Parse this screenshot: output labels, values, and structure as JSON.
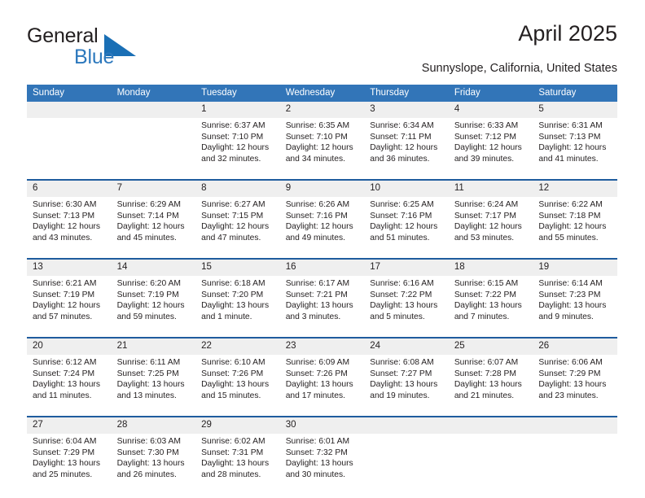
{
  "brand": {
    "name_part1": "General",
    "name_part2": "Blue",
    "flag_icon": "blue-triangle-flag-icon"
  },
  "header": {
    "title": "April 2025",
    "subtitle": "Sunnyslope, California, United States"
  },
  "colors": {
    "header_blue": "#3275b8",
    "separator_blue": "#1f5c9e",
    "daynum_band": "#efefef",
    "brand_blue": "#2c78bd",
    "text": "#231f20"
  },
  "weekdays": [
    "Sunday",
    "Monday",
    "Tuesday",
    "Wednesday",
    "Thursday",
    "Friday",
    "Saturday"
  ],
  "weeks": [
    [
      {
        "day": "",
        "sunrise": "",
        "sunset": "",
        "daylight1": "",
        "daylight2": ""
      },
      {
        "day": "",
        "sunrise": "",
        "sunset": "",
        "daylight1": "",
        "daylight2": ""
      },
      {
        "day": "1",
        "sunrise": "Sunrise: 6:37 AM",
        "sunset": "Sunset: 7:10 PM",
        "daylight1": "Daylight: 12 hours",
        "daylight2": "and 32 minutes."
      },
      {
        "day": "2",
        "sunrise": "Sunrise: 6:35 AM",
        "sunset": "Sunset: 7:10 PM",
        "daylight1": "Daylight: 12 hours",
        "daylight2": "and 34 minutes."
      },
      {
        "day": "3",
        "sunrise": "Sunrise: 6:34 AM",
        "sunset": "Sunset: 7:11 PM",
        "daylight1": "Daylight: 12 hours",
        "daylight2": "and 36 minutes."
      },
      {
        "day": "4",
        "sunrise": "Sunrise: 6:33 AM",
        "sunset": "Sunset: 7:12 PM",
        "daylight1": "Daylight: 12 hours",
        "daylight2": "and 39 minutes."
      },
      {
        "day": "5",
        "sunrise": "Sunrise: 6:31 AM",
        "sunset": "Sunset: 7:13 PM",
        "daylight1": "Daylight: 12 hours",
        "daylight2": "and 41 minutes."
      }
    ],
    [
      {
        "day": "6",
        "sunrise": "Sunrise: 6:30 AM",
        "sunset": "Sunset: 7:13 PM",
        "daylight1": "Daylight: 12 hours",
        "daylight2": "and 43 minutes."
      },
      {
        "day": "7",
        "sunrise": "Sunrise: 6:29 AM",
        "sunset": "Sunset: 7:14 PM",
        "daylight1": "Daylight: 12 hours",
        "daylight2": "and 45 minutes."
      },
      {
        "day": "8",
        "sunrise": "Sunrise: 6:27 AM",
        "sunset": "Sunset: 7:15 PM",
        "daylight1": "Daylight: 12 hours",
        "daylight2": "and 47 minutes."
      },
      {
        "day": "9",
        "sunrise": "Sunrise: 6:26 AM",
        "sunset": "Sunset: 7:16 PM",
        "daylight1": "Daylight: 12 hours",
        "daylight2": "and 49 minutes."
      },
      {
        "day": "10",
        "sunrise": "Sunrise: 6:25 AM",
        "sunset": "Sunset: 7:16 PM",
        "daylight1": "Daylight: 12 hours",
        "daylight2": "and 51 minutes."
      },
      {
        "day": "11",
        "sunrise": "Sunrise: 6:24 AM",
        "sunset": "Sunset: 7:17 PM",
        "daylight1": "Daylight: 12 hours",
        "daylight2": "and 53 minutes."
      },
      {
        "day": "12",
        "sunrise": "Sunrise: 6:22 AM",
        "sunset": "Sunset: 7:18 PM",
        "daylight1": "Daylight: 12 hours",
        "daylight2": "and 55 minutes."
      }
    ],
    [
      {
        "day": "13",
        "sunrise": "Sunrise: 6:21 AM",
        "sunset": "Sunset: 7:19 PM",
        "daylight1": "Daylight: 12 hours",
        "daylight2": "and 57 minutes."
      },
      {
        "day": "14",
        "sunrise": "Sunrise: 6:20 AM",
        "sunset": "Sunset: 7:19 PM",
        "daylight1": "Daylight: 12 hours",
        "daylight2": "and 59 minutes."
      },
      {
        "day": "15",
        "sunrise": "Sunrise: 6:18 AM",
        "sunset": "Sunset: 7:20 PM",
        "daylight1": "Daylight: 13 hours",
        "daylight2": "and 1 minute."
      },
      {
        "day": "16",
        "sunrise": "Sunrise: 6:17 AM",
        "sunset": "Sunset: 7:21 PM",
        "daylight1": "Daylight: 13 hours",
        "daylight2": "and 3 minutes."
      },
      {
        "day": "17",
        "sunrise": "Sunrise: 6:16 AM",
        "sunset": "Sunset: 7:22 PM",
        "daylight1": "Daylight: 13 hours",
        "daylight2": "and 5 minutes."
      },
      {
        "day": "18",
        "sunrise": "Sunrise: 6:15 AM",
        "sunset": "Sunset: 7:22 PM",
        "daylight1": "Daylight: 13 hours",
        "daylight2": "and 7 minutes."
      },
      {
        "day": "19",
        "sunrise": "Sunrise: 6:14 AM",
        "sunset": "Sunset: 7:23 PM",
        "daylight1": "Daylight: 13 hours",
        "daylight2": "and 9 minutes."
      }
    ],
    [
      {
        "day": "20",
        "sunrise": "Sunrise: 6:12 AM",
        "sunset": "Sunset: 7:24 PM",
        "daylight1": "Daylight: 13 hours",
        "daylight2": "and 11 minutes."
      },
      {
        "day": "21",
        "sunrise": "Sunrise: 6:11 AM",
        "sunset": "Sunset: 7:25 PM",
        "daylight1": "Daylight: 13 hours",
        "daylight2": "and 13 minutes."
      },
      {
        "day": "22",
        "sunrise": "Sunrise: 6:10 AM",
        "sunset": "Sunset: 7:26 PM",
        "daylight1": "Daylight: 13 hours",
        "daylight2": "and 15 minutes."
      },
      {
        "day": "23",
        "sunrise": "Sunrise: 6:09 AM",
        "sunset": "Sunset: 7:26 PM",
        "daylight1": "Daylight: 13 hours",
        "daylight2": "and 17 minutes."
      },
      {
        "day": "24",
        "sunrise": "Sunrise: 6:08 AM",
        "sunset": "Sunset: 7:27 PM",
        "daylight1": "Daylight: 13 hours",
        "daylight2": "and 19 minutes."
      },
      {
        "day": "25",
        "sunrise": "Sunrise: 6:07 AM",
        "sunset": "Sunset: 7:28 PM",
        "daylight1": "Daylight: 13 hours",
        "daylight2": "and 21 minutes."
      },
      {
        "day": "26",
        "sunrise": "Sunrise: 6:06 AM",
        "sunset": "Sunset: 7:29 PM",
        "daylight1": "Daylight: 13 hours",
        "daylight2": "and 23 minutes."
      }
    ],
    [
      {
        "day": "27",
        "sunrise": "Sunrise: 6:04 AM",
        "sunset": "Sunset: 7:29 PM",
        "daylight1": "Daylight: 13 hours",
        "daylight2": "and 25 minutes."
      },
      {
        "day": "28",
        "sunrise": "Sunrise: 6:03 AM",
        "sunset": "Sunset: 7:30 PM",
        "daylight1": "Daylight: 13 hours",
        "daylight2": "and 26 minutes."
      },
      {
        "day": "29",
        "sunrise": "Sunrise: 6:02 AM",
        "sunset": "Sunset: 7:31 PM",
        "daylight1": "Daylight: 13 hours",
        "daylight2": "and 28 minutes."
      },
      {
        "day": "30",
        "sunrise": "Sunrise: 6:01 AM",
        "sunset": "Sunset: 7:32 PM",
        "daylight1": "Daylight: 13 hours",
        "daylight2": "and 30 minutes."
      },
      {
        "day": "",
        "sunrise": "",
        "sunset": "",
        "daylight1": "",
        "daylight2": ""
      },
      {
        "day": "",
        "sunrise": "",
        "sunset": "",
        "daylight1": "",
        "daylight2": ""
      },
      {
        "day": "",
        "sunrise": "",
        "sunset": "",
        "daylight1": "",
        "daylight2": ""
      }
    ]
  ]
}
